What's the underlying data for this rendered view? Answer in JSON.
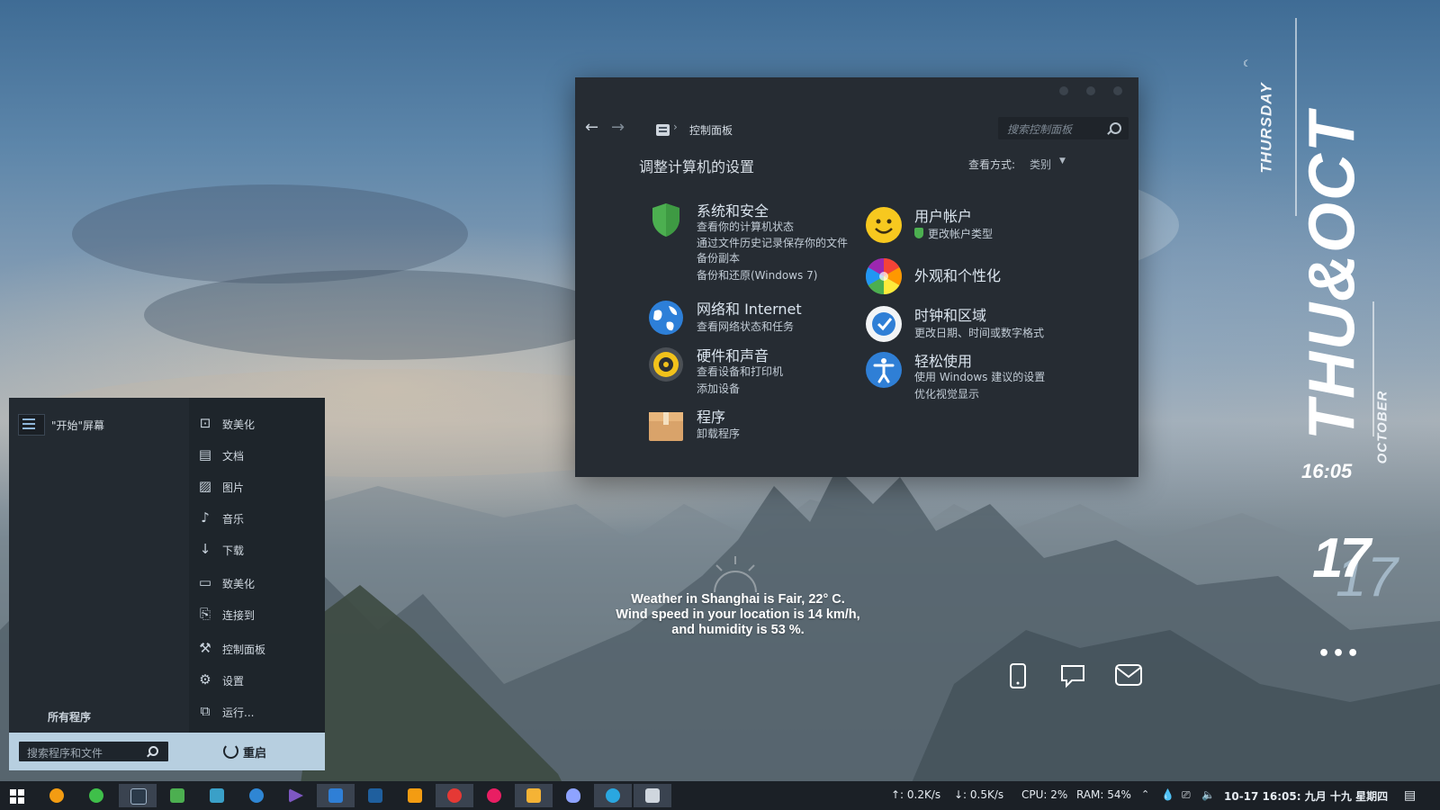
{
  "control_panel": {
    "address": "控制面板",
    "search_placeholder": "搜索控制面板",
    "heading": "调整计算机的设置",
    "view_label": "查看方式:",
    "view_value": "类别",
    "categories": [
      {
        "title": "系统和安全",
        "links": [
          "查看你的计算机状态",
          "通过文件历史记录保存你的文件",
          "备份副本",
          "备份和还原(Windows 7)"
        ]
      },
      {
        "title": "网络和 Internet",
        "links": [
          "查看网络状态和任务"
        ]
      },
      {
        "title": "硬件和声音",
        "links": [
          "查看设备和打印机",
          "添加设备"
        ]
      },
      {
        "title": "程序",
        "links": [
          "卸载程序"
        ]
      },
      {
        "title": "用户帐户",
        "links": [
          "更改帐户类型"
        ]
      },
      {
        "title": "外观和个性化",
        "links": []
      },
      {
        "title": "时钟和区域",
        "links": [
          "更改日期、时间或数字格式"
        ]
      },
      {
        "title": "轻松使用",
        "links": [
          "使用 Windows 建议的设置",
          "优化视觉显示"
        ]
      }
    ]
  },
  "start_menu": {
    "start_screen": "\"开始\"屏幕",
    "all_programs": "所有程序",
    "items": [
      {
        "label": "致美化",
        "icon": "user-icon"
      },
      {
        "label": "文档",
        "icon": "document-icon"
      },
      {
        "label": "图片",
        "icon": "picture-icon"
      },
      {
        "label": "音乐",
        "icon": "music-icon"
      },
      {
        "label": "下载",
        "icon": "download-icon"
      },
      {
        "label": "致美化",
        "icon": "computer-icon"
      },
      {
        "label": "连接到",
        "icon": "connect-icon"
      },
      {
        "label": "控制面板",
        "icon": "wrench-icon"
      },
      {
        "label": "设置",
        "icon": "gear-icon"
      },
      {
        "label": "运行...",
        "icon": "run-icon"
      }
    ],
    "search_placeholder": "搜索程序和文件",
    "restart": "重启"
  },
  "weather": {
    "line1": "Weather in Shanghai is Fair, 22° C.",
    "line2": "Wind speed in your location is 14 km/h,",
    "line3": "and humidity is 53 %."
  },
  "clock_widget": {
    "day": "THURSDAY",
    "big": "THU&OCT",
    "month": "OCTOBER",
    "time": "16:05",
    "date": "17"
  },
  "taskbar": {
    "upload": "↑: 0.2K/s",
    "download": "↓: 0.5K/s",
    "cpu": "CPU: 2%",
    "ram": "RAM: 54%",
    "datetime": "10-17  16:05:  九月 十九  星期四"
  },
  "colors": {
    "window_bg": "#262c33",
    "taskbar_bg": "#1b2026",
    "accent_blue": "#2f7fd6"
  }
}
